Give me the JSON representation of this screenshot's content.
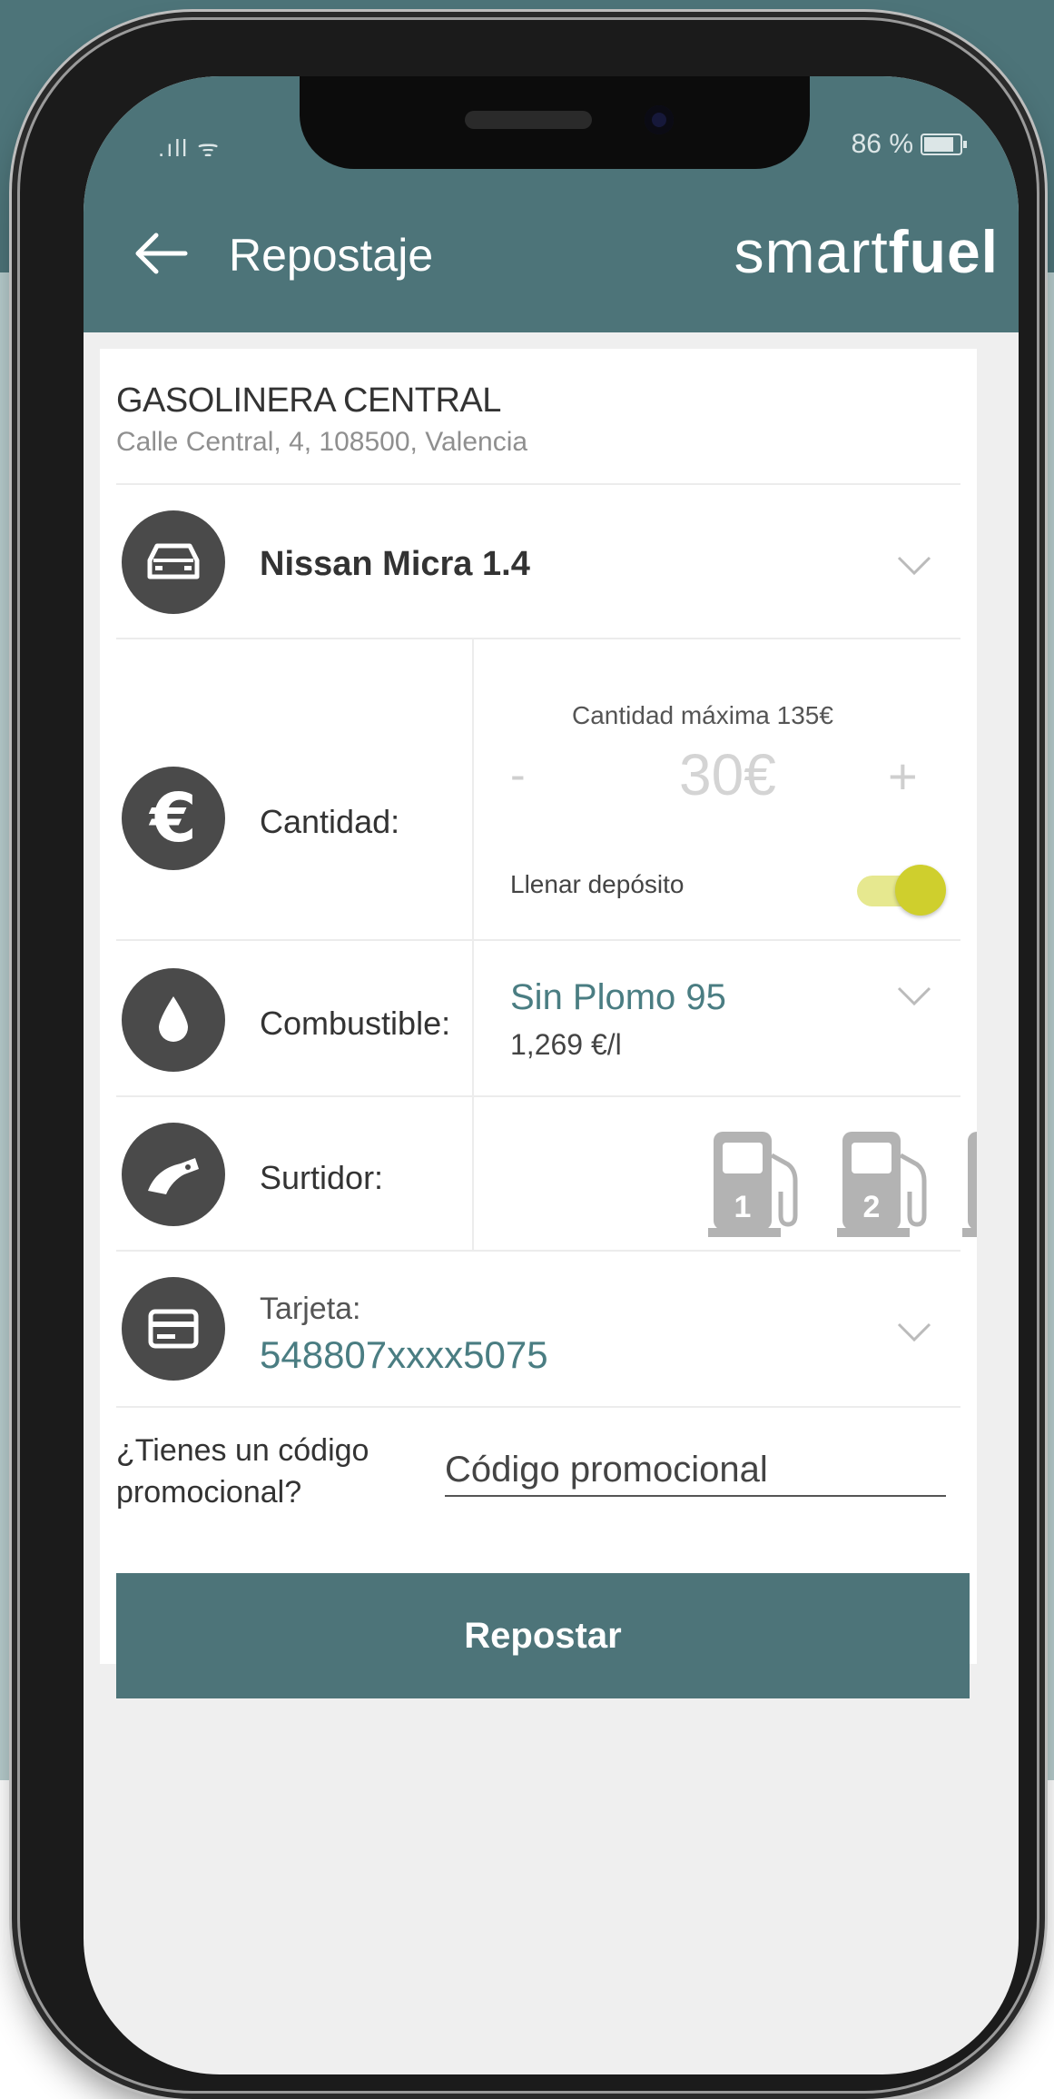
{
  "status_bar": {
    "signal": ".ıll ᯤ",
    "battery": "86 %"
  },
  "header": {
    "title": "Repostaje",
    "brand_light": "smart",
    "brand_bold": "fuel"
  },
  "station": {
    "name": "GASOLINERA CENTRAL",
    "address": "Calle Central, 4, 108500, Valencia"
  },
  "vehicle": {
    "name": "Nissan Micra 1.4",
    "icon": "car-icon"
  },
  "quantity": {
    "label": "Cantidad:",
    "max_text": "Cantidad máxima 135€",
    "minus": "-",
    "value": "30€",
    "plus": "+",
    "fill_label": "Llenar depósito",
    "fill_enabled": true,
    "icon": "euro-icon"
  },
  "fuel": {
    "label": "Combustible:",
    "name": "Sin Plomo 95",
    "price": "1,269 €/l",
    "icon": "drop-icon"
  },
  "pump": {
    "label": "Surtidor:",
    "numbers": [
      "1",
      "2"
    ],
    "icon": "fuel-nozzle-icon"
  },
  "payment_card": {
    "label": "Tarjeta:",
    "number": "548807xxxx5075",
    "icon": "credit-card-icon"
  },
  "promo": {
    "question": "¿Tienes un código promocional?",
    "placeholder": "Código promocional"
  },
  "submit": {
    "label": "Repostar"
  },
  "colors": {
    "accent": "#4d7479",
    "text_teal": "#4a7d82",
    "toggle": "#cfcf2d",
    "icon_bg": "#4a4a4a"
  }
}
